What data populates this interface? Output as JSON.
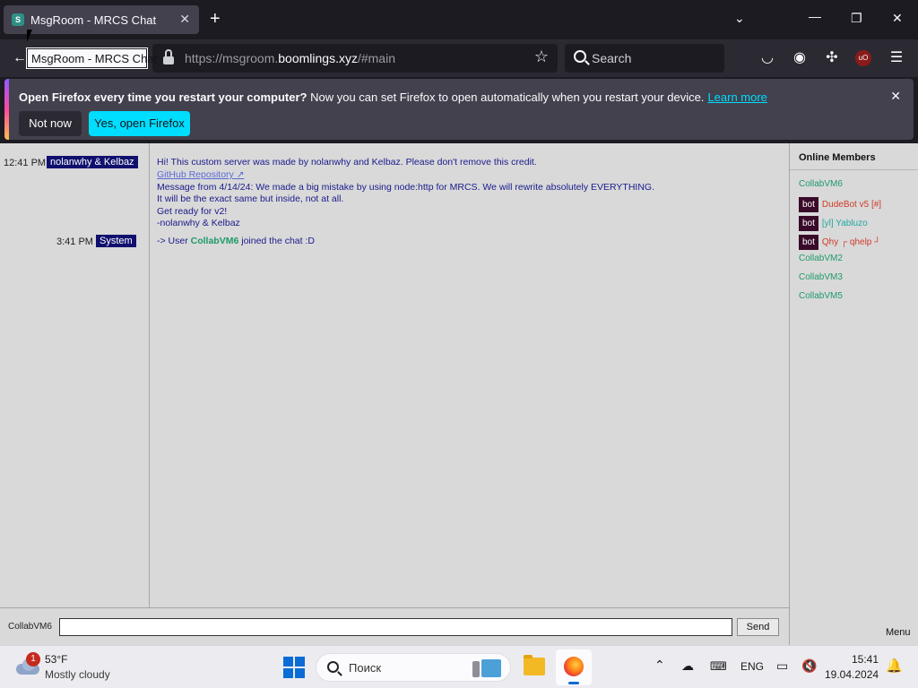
{
  "browser": {
    "tab_title": "MsgRoom - MRCS Chat",
    "tooltip": "MsgRoom - MRCS Chat",
    "url_prefix": "https://msgroom.",
    "url_host": "boomlings.xyz",
    "url_suffix": "/#main",
    "search_placeholder": "Search"
  },
  "notification": {
    "bold_text": "Open Firefox every time you restart your computer?",
    "text": " Now you can set Firefox to open automatically when you restart your device.",
    "link": "Learn more",
    "not_now": "Not now",
    "yes": "Yes, open Firefox"
  },
  "chat": {
    "messages": [
      {
        "time": "12:41 PM",
        "user": "nolanwhy & Kelbaz",
        "lines": [
          "Hi! This custom server was made by nolanwhy and Kelbaz. Please don't remove this credit.",
          "GitHub Repository ↗",
          "Message from 4/14/24: We made a big mistake by using node:http for MRCS. We will rewrite absolutely EVERYTHING.",
          "It will be the exact same but inside, not at all.",
          "Get ready for v2!",
          "-nolanwhy & Kelbaz"
        ]
      },
      {
        "time": "3:41 PM",
        "user": "System",
        "prefix": "-> User ",
        "highlight": "CollabVM6",
        "suffix": " joined the chat :D"
      }
    ],
    "nick": "CollabVM6",
    "input_value": "",
    "send": "Send"
  },
  "members": {
    "title": "Online Members",
    "bot_label": "bot",
    "list": [
      {
        "name": "CollabVM6",
        "bot": false,
        "color": "#1e9a6a"
      },
      {
        "name": "DudeBot v5 [#]",
        "bot": true,
        "color": "#d03a2a"
      },
      {
        "name": "[yl] Yabluzo",
        "bot": true,
        "color": "#22a8a0"
      },
      {
        "name": "Qhy ┌ qhelp ┘",
        "bot": true,
        "color": "#d03a2a"
      },
      {
        "name": "CollabVM2",
        "bot": false,
        "color": "#1e9a6a"
      },
      {
        "name": "CollabVM3",
        "bot": false,
        "color": "#1e9a6a"
      },
      {
        "name": "CollabVM5",
        "bot": false,
        "color": "#1e9a6a"
      }
    ],
    "menu": "Menu"
  },
  "taskbar": {
    "badge": "1",
    "temp": "53°F",
    "condition": "Mostly cloudy",
    "search": "Поиск",
    "lang": "ENG",
    "time": "15:41",
    "date": "19.04.2024"
  }
}
